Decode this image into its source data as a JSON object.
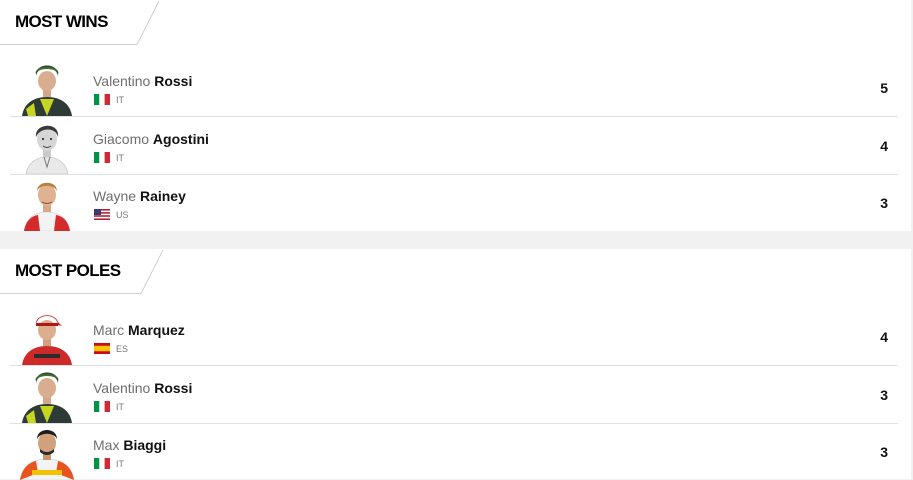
{
  "most_wins": {
    "title": "MOST WINS",
    "riders": [
      {
        "first": "Valentino",
        "last": "Rossi",
        "country": "IT",
        "flag": "italy",
        "count": "5",
        "avatar": "rider-yellow-helmet"
      },
      {
        "first": "Giacomo",
        "last": "Agostini",
        "country": "IT",
        "flag": "italy",
        "count": "4",
        "avatar": "rider-vintage"
      },
      {
        "first": "Wayne",
        "last": "Rainey",
        "country": "US",
        "flag": "usa",
        "count": "3",
        "avatar": "rider-red-white"
      }
    ]
  },
  "most_poles": {
    "title": "MOST POLES",
    "riders": [
      {
        "first": "Marc",
        "last": "Marquez",
        "country": "ES",
        "flag": "spain",
        "count": "4",
        "avatar": "rider-red-cap"
      },
      {
        "first": "Valentino",
        "last": "Rossi",
        "country": "IT",
        "flag": "italy",
        "count": "3",
        "avatar": "rider-yellow-helmet"
      },
      {
        "first": "Max",
        "last": "Biaggi",
        "country": "IT",
        "flag": "italy",
        "count": "3",
        "avatar": "rider-repsol"
      }
    ]
  }
}
